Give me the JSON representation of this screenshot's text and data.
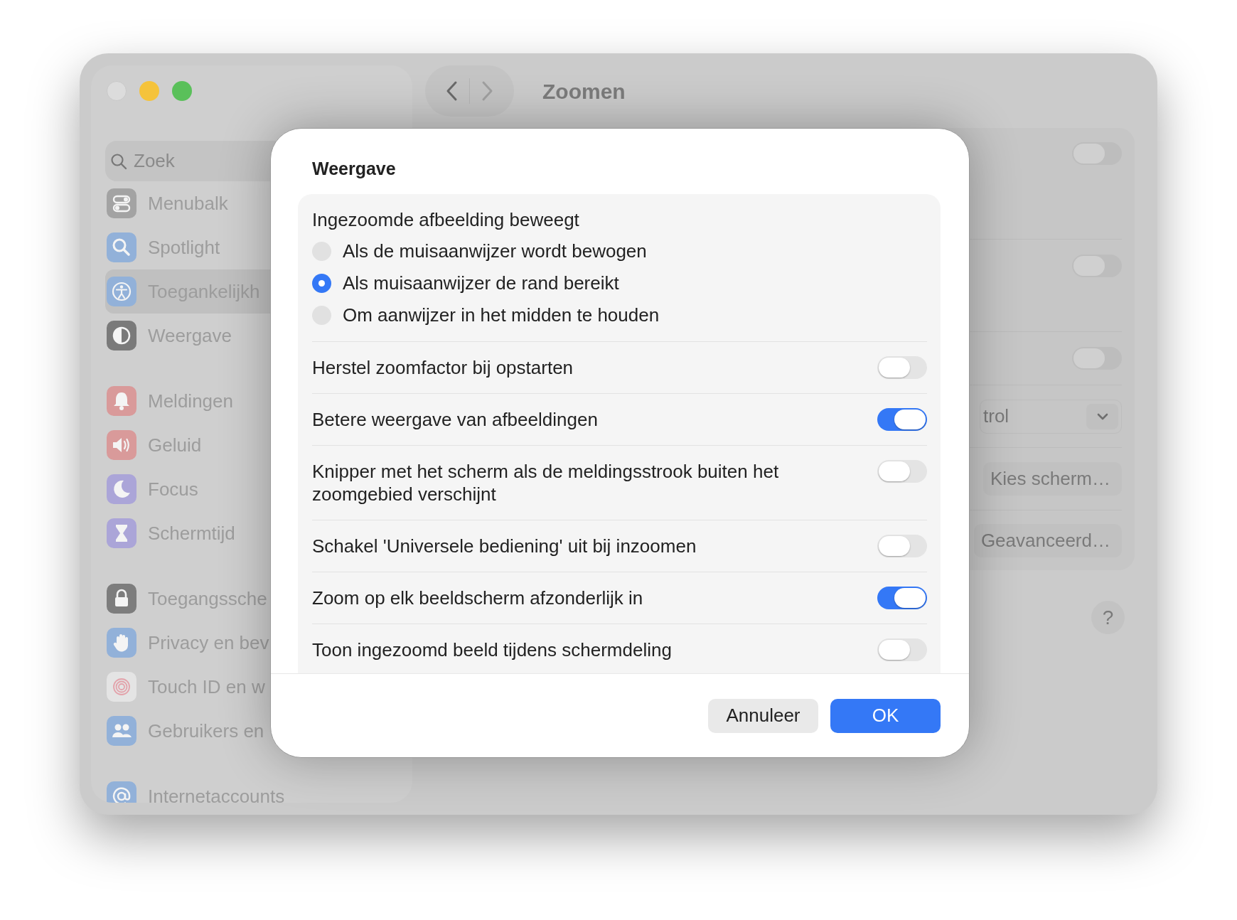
{
  "window": {
    "title": "Zoomen"
  },
  "sidebar": {
    "search": {
      "placeholder": "Zoek"
    },
    "groups": [
      {
        "items": [
          {
            "label": "Menubalk",
            "selected": false,
            "color": "#a3a3a3"
          },
          {
            "label": "Spotlight",
            "selected": false,
            "color": "#92b1d9"
          },
          {
            "label": "Toegankelijkh",
            "selected": true,
            "color": "#92b1d9"
          },
          {
            "label": "Weergave",
            "selected": false,
            "color": "#7a7a7a"
          }
        ]
      },
      {
        "items": [
          {
            "label": "Meldingen",
            "selected": false,
            "color": "#d99a9a"
          },
          {
            "label": "Geluid",
            "selected": false,
            "color": "#d99a9a"
          },
          {
            "label": "Focus",
            "selected": false,
            "color": "#aba5d8"
          },
          {
            "label": "Schermtijd",
            "selected": false,
            "color": "#aba5d8"
          }
        ]
      },
      {
        "items": [
          {
            "label": "Toegangssche",
            "selected": false,
            "color": "#7d7d7d"
          },
          {
            "label": "Privacy en bev",
            "selected": false,
            "color": "#92b1d9"
          },
          {
            "label": "Touch ID en w",
            "selected": false,
            "color": "#e4e4e4"
          },
          {
            "label": "Gebruikers en",
            "selected": false,
            "color": "#92b1d9"
          }
        ]
      },
      {
        "items": [
          {
            "label": "Internetaccounts",
            "selected": false,
            "color": "#92b1d9"
          }
        ]
      }
    ]
  },
  "settings_panel": {
    "toggles": [
      {
        "on": false
      },
      {
        "on": false
      },
      {
        "on": false
      }
    ],
    "dropdown": {
      "value": "trol"
    },
    "buttons": [
      "Kies scherm…",
      "Geavanceerd…"
    ],
    "help": "?"
  },
  "dialog": {
    "title": "Weergave",
    "heading": "Ingezoomde afbeelding beweegt",
    "options": [
      {
        "label": "Als de muisaanwijzer wordt bewogen",
        "selected": false
      },
      {
        "label": "Als muisaanwijzer de rand bereikt",
        "selected": true
      },
      {
        "label": "Om aanwijzer in het midden te houden",
        "selected": false
      }
    ],
    "toggles": [
      {
        "label": "Herstel zoomfactor bij opstarten",
        "on": false
      },
      {
        "label": "Betere weergave van afbeeldingen",
        "on": true
      },
      {
        "label": "Knipper met het scherm als de meldingsstrook buiten het zoomgebied verschijnt",
        "on": false
      },
      {
        "label": "Schakel 'Universele bediening' uit bij inzoomen",
        "on": false
      },
      {
        "label": "Zoom op elk beeldscherm afzonderlijk in",
        "on": true
      },
      {
        "label": "Toon ingezoomd beeld tijdens schermdeling",
        "on": false
      }
    ],
    "buttons": [
      {
        "label": "Annuleer",
        "kind": "secondary"
      },
      {
        "label": "OK",
        "kind": "primary"
      }
    ]
  }
}
